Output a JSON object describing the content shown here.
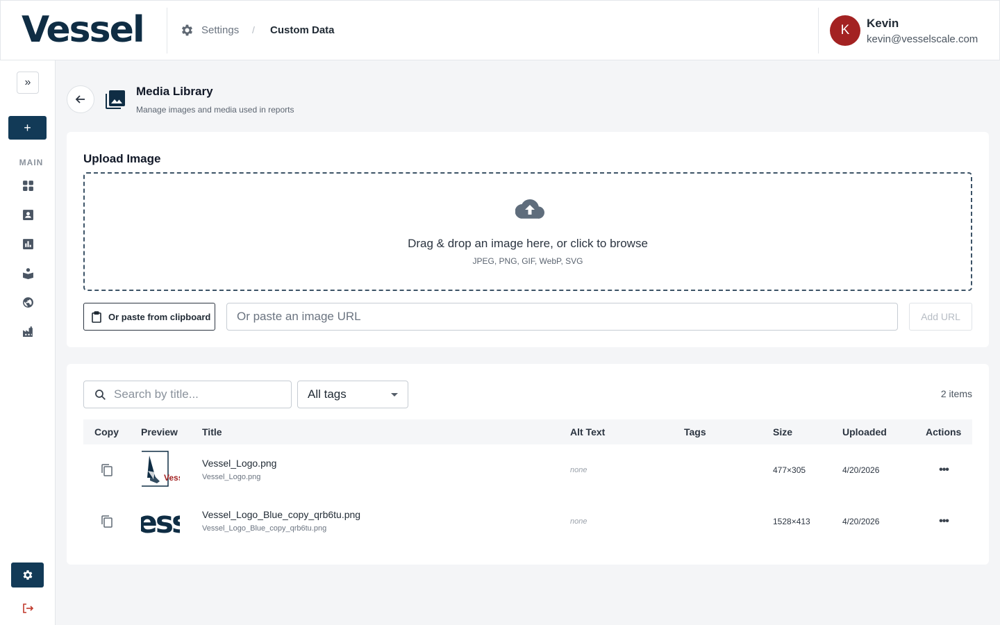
{
  "header": {
    "logo": "Vessel",
    "breadcrumb": {
      "settings": "Settings",
      "separator": "/",
      "current": "Custom Data"
    },
    "user": {
      "initial": "K",
      "name": "Kevin",
      "email": "kevin@vesselscale.com"
    }
  },
  "sidebar": {
    "expand_icon": "»",
    "new_label": "+",
    "section_label": "MAIN",
    "items": [
      {
        "icon": "dashboard-icon"
      },
      {
        "icon": "contacts-icon"
      },
      {
        "icon": "reports-icon"
      },
      {
        "icon": "learning-icon"
      },
      {
        "icon": "globe-icon"
      },
      {
        "icon": "factory-icon"
      }
    ],
    "settings_icon": "gear-icon",
    "logout_icon": "logout-icon"
  },
  "page": {
    "title": "Media Library",
    "subtitle": "Manage images and media used in reports"
  },
  "upload": {
    "title": "Upload Image",
    "drop_text": "Drag & drop an image here, or click to browse",
    "formats": "JPEG, PNG, GIF, WebP, SVG",
    "clipboard_label": "Or paste from clipboard",
    "url_placeholder": "Or paste an image URL",
    "url_value": "",
    "add_url_label": "Add URL"
  },
  "library": {
    "search_placeholder": "Search by title...",
    "search_value": "",
    "tag_filter": "All tags",
    "count": "2 items",
    "columns": [
      "Copy",
      "Preview",
      "Title",
      "Alt Text",
      "Tags",
      "Size",
      "Uploaded",
      "Actions"
    ],
    "rows": [
      {
        "title": "Vessel_Logo.png",
        "filename": "Vessel_Logo.png",
        "preview_text": "Vess",
        "alt": "none",
        "tags": "",
        "size": "477×305",
        "uploaded": "4/20/2026",
        "actions": "•••"
      },
      {
        "title": "Vessel_Logo_Blue_copy_qrb6tu.png",
        "filename": "Vessel_Logo_Blue_copy_qrb6tu.png",
        "preview_text": "ess",
        "alt": "none",
        "tags": "",
        "size": "1528×413",
        "uploaded": "4/20/2026",
        "actions": "•••"
      }
    ]
  },
  "colors": {
    "brand_navy": "#0f2d44",
    "primary_button": "#123a57",
    "avatar": "#a32222",
    "logout": "#c0392b"
  }
}
